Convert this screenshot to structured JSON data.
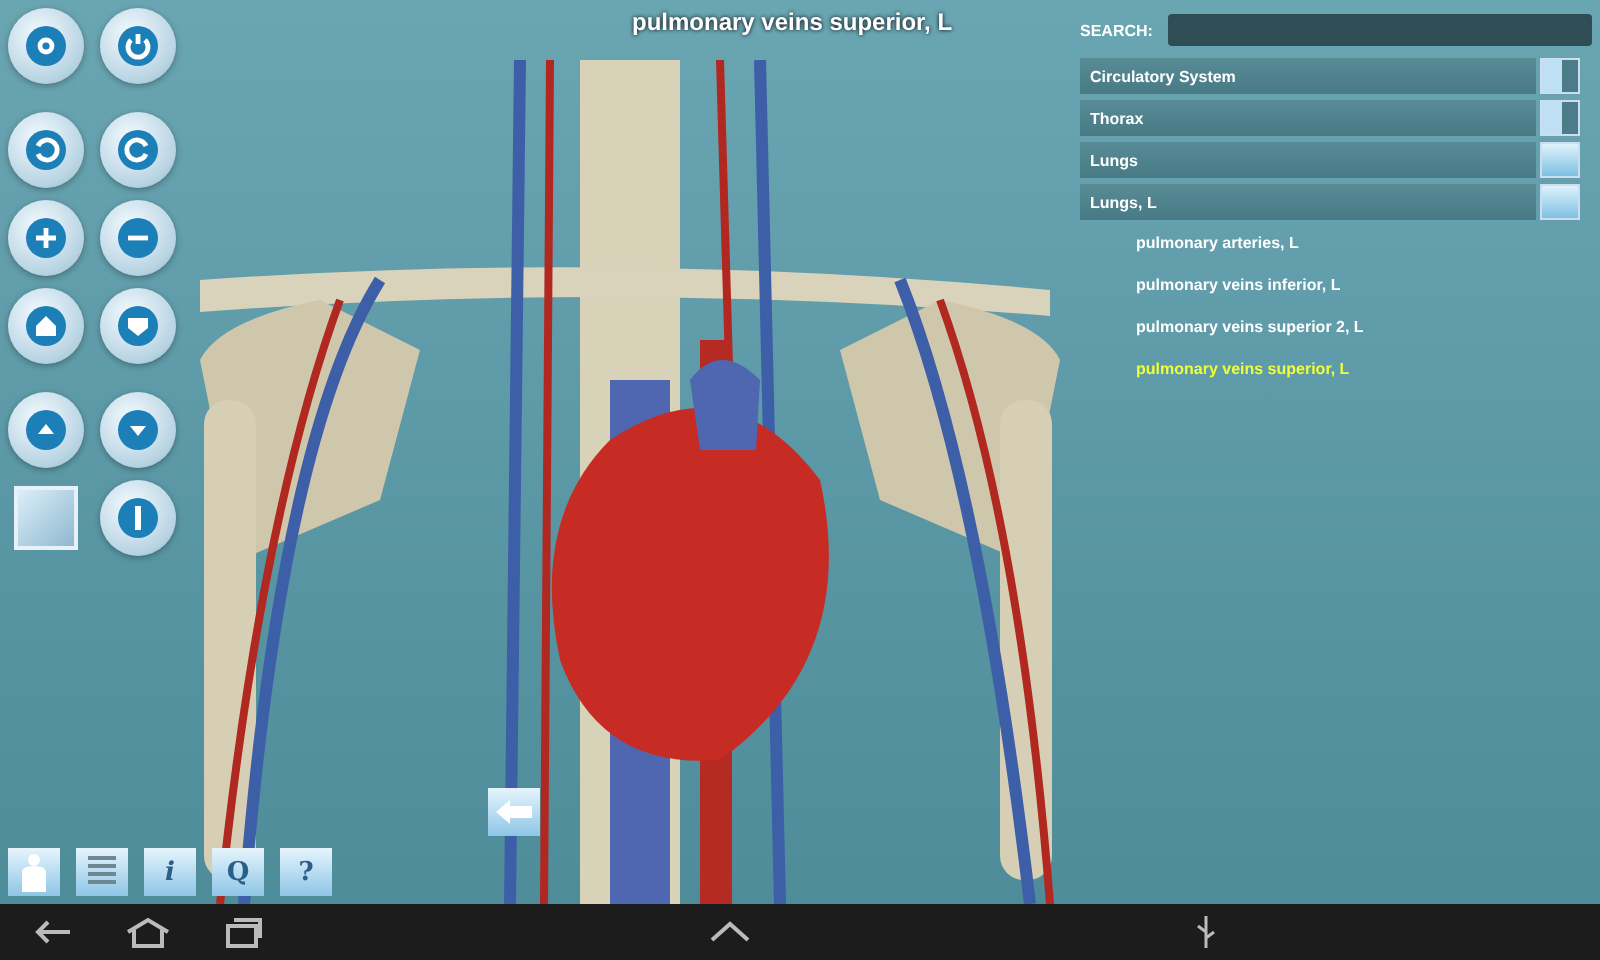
{
  "title": "pulmonary veins superior, L",
  "search": {
    "label": "SEARCH:"
  },
  "categories": [
    {
      "label": "Circulatory System",
      "partial": true
    },
    {
      "label": "Thorax",
      "partial": true
    },
    {
      "label": "Lungs",
      "partial": false
    },
    {
      "label": "Lungs, L",
      "partial": false,
      "children": [
        {
          "label": "pulmonary arteries, L",
          "selected": false
        },
        {
          "label": "pulmonary veins inferior, L",
          "selected": false
        },
        {
          "label": "pulmonary veins superior 2, L",
          "selected": false
        },
        {
          "label": "pulmonary veins superior, L",
          "selected": true
        }
      ]
    }
  ],
  "toolbar": [
    {
      "kind": "body"
    },
    {
      "kind": "layers"
    },
    {
      "kind": "glyph",
      "glyph": "i"
    },
    {
      "kind": "glyph",
      "glyph": "Q"
    },
    {
      "kind": "glyph",
      "glyph": "?"
    }
  ]
}
